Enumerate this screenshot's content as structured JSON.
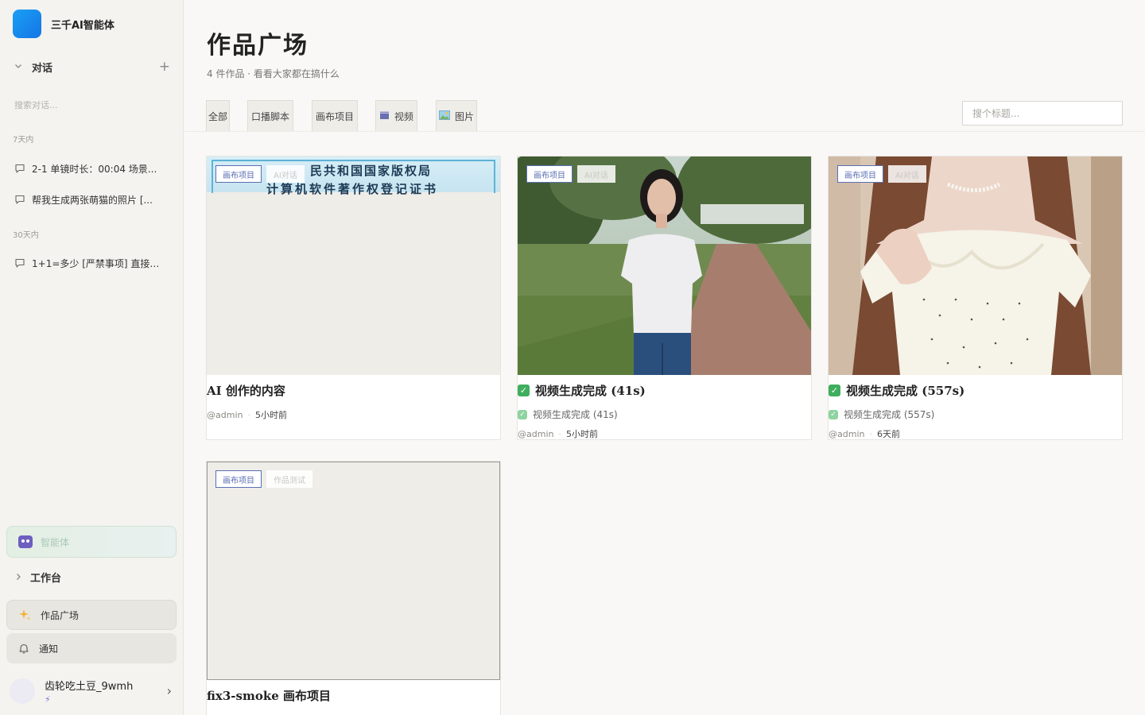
{
  "sidebar": {
    "brand": "三千AI智能体",
    "chat_section": "对话",
    "search_placeholder": "搜索对话...",
    "groups": [
      {
        "label": "7天内",
        "items": [
          "2-1 单镜时长：00:04 场景...",
          "帮我生成两张萌猫的照片 [..."
        ]
      },
      {
        "label": "30天内",
        "items": [
          "1+1=多少 [严禁事项] 直接生..."
        ]
      }
    ],
    "agent": "智能体",
    "workbench": "工作台",
    "gallery": "作品广场",
    "notifications": "通知",
    "user": {
      "name": "齿轮吃土豆_9wmh"
    }
  },
  "main": {
    "title": "作品广场",
    "subtitle": "4 件作品 · 看看大家都在搞什么",
    "filters": [
      "全部",
      "口播脚本",
      "画布项目",
      "视频",
      "图片"
    ],
    "search_placeholder": "搜个标题..."
  },
  "cards": [
    {
      "tags": [
        "画布项目",
        "AI对话"
      ],
      "art_text": [
        "民共和国国家版权局",
        "计算机软件著作权登记证书"
      ],
      "title": "AI 创作的内容",
      "author": "@admin",
      "time": "5小时前"
    },
    {
      "tags": [
        "画布项目",
        "AI对话"
      ],
      "title": "视频生成完成 (41s)",
      "desc": "视频生成完成 (41s)",
      "author": "@admin",
      "time": "5小时前"
    },
    {
      "tags": [
        "画布项目",
        "AI对话"
      ],
      "title": "视频生成完成 (557s)",
      "desc": "视频生成完成 (557s)",
      "author": "@admin",
      "time": "6天前"
    },
    {
      "tags": [
        "画布项目",
        "作品测试"
      ],
      "title": "fix3-smoke 画布项目"
    }
  ],
  "colors": {
    "accent": "#5b6fb4",
    "success": "#3fae5e",
    "brand": "#1574e6"
  }
}
